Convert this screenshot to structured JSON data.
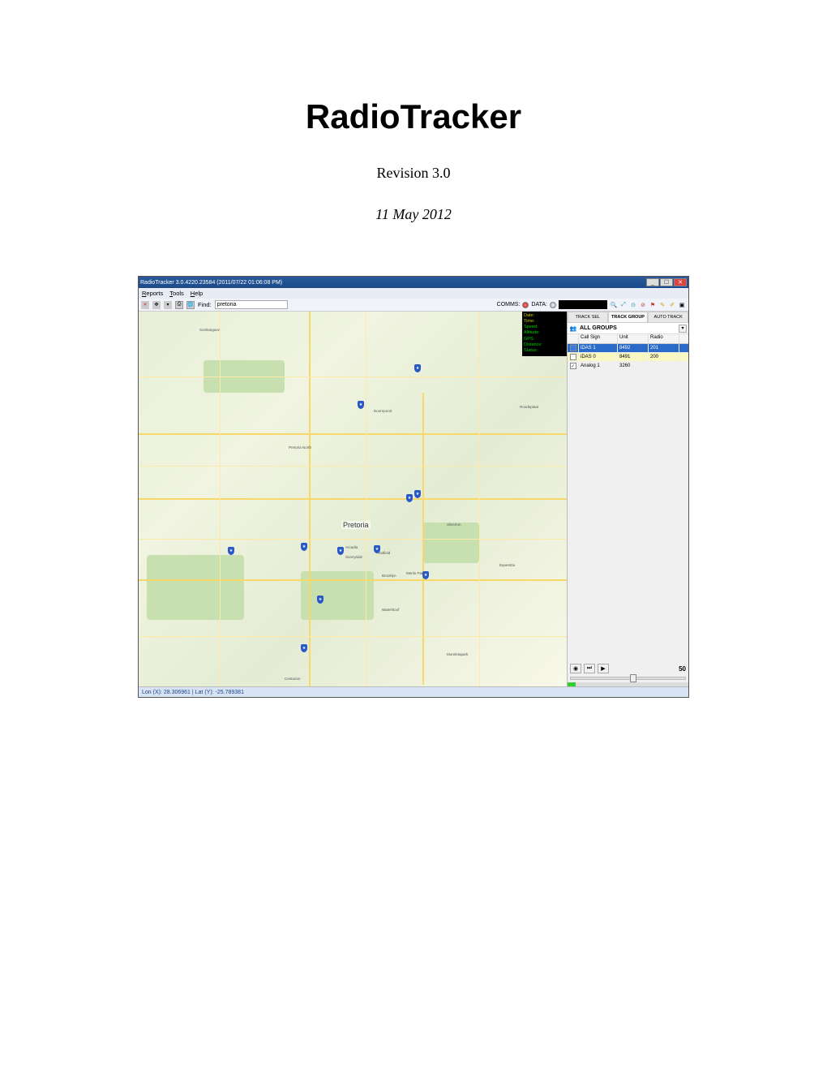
{
  "doc": {
    "title": "RadioTracker",
    "revision": "Revision 3.0",
    "date": "11 May 2012"
  },
  "app": {
    "titlebar": "RadioTracker 3.0.4220.23584 (2011/07/22 01:06:08 PM)",
    "menu": {
      "reports": "Reports",
      "tools": "Tools",
      "help": "Help"
    },
    "toolbar": {
      "find_label": "Find:",
      "find_value": "pretoria",
      "comms_label": "COMMS:",
      "data_label": "DATA:"
    },
    "overlay": {
      "date": "Date:",
      "time": "Time:",
      "speed": "Speed:",
      "altitude": "Altitude:",
      "gps": "GPS:",
      "distance": "Distance:",
      "status": "Status:"
    },
    "panel": {
      "tabs": {
        "sel": "TRACK SEL",
        "group": "TRACK GROUP",
        "auto": "AUTO TRACK"
      },
      "group_label": "ALL GROUPS",
      "headers": {
        "callsign": "Call Sign",
        "unit": "Unit",
        "radio": "Radio"
      },
      "rows": [
        {
          "callsign": "iDAS 1",
          "unit": "8492",
          "radio": "201"
        },
        {
          "callsign": "iDAS 0",
          "unit": "8491",
          "radio": "200"
        },
        {
          "callsign": "Analog 1",
          "unit": "3260",
          "radio": ""
        }
      ],
      "speed_value": "50"
    },
    "map": {
      "city": "Pretoria",
      "places": [
        "Soshanguve",
        "Pretoria North",
        "Sunnyside",
        "Brooklyn",
        "Menlo Park",
        "Hatfield",
        "Arcadia",
        "Centurion",
        "Doornpoort",
        "Roodeplaat",
        "Waterkloof",
        "Silverton",
        "Equestria",
        "Moreletapark"
      ]
    },
    "statusbar": "Lon (X): 28.306961  |  Lat (Y): -25.789381"
  }
}
